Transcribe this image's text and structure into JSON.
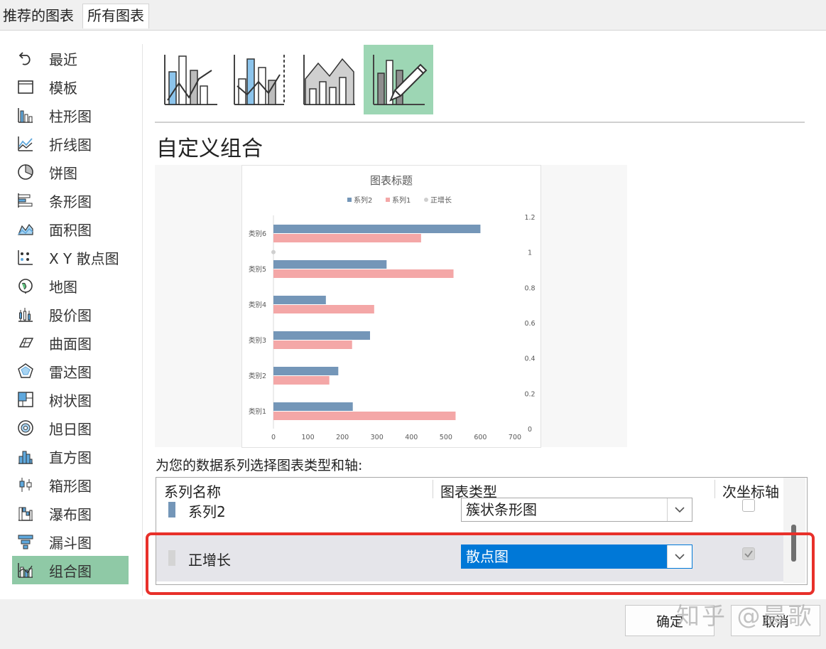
{
  "tabs": [
    {
      "label": "推荐的图表"
    },
    {
      "label": "所有图表"
    }
  ],
  "sidebar": {
    "items": [
      {
        "label": "最近",
        "icon": "recent-icon"
      },
      {
        "label": "模板",
        "icon": "folder-icon"
      },
      {
        "label": "柱形图",
        "icon": "column-chart-icon"
      },
      {
        "label": "折线图",
        "icon": "line-chart-icon"
      },
      {
        "label": "饼图",
        "icon": "pie-chart-icon"
      },
      {
        "label": "条形图",
        "icon": "bar-chart-icon"
      },
      {
        "label": "面积图",
        "icon": "area-chart-icon"
      },
      {
        "label": "X Y 散点图",
        "icon": "scatter-chart-icon"
      },
      {
        "label": "地图",
        "icon": "map-chart-icon"
      },
      {
        "label": "股价图",
        "icon": "stock-chart-icon"
      },
      {
        "label": "曲面图",
        "icon": "surface-chart-icon"
      },
      {
        "label": "雷达图",
        "icon": "radar-chart-icon"
      },
      {
        "label": "树状图",
        "icon": "treemap-chart-icon"
      },
      {
        "label": "旭日图",
        "icon": "sunburst-chart-icon"
      },
      {
        "label": "直方图",
        "icon": "histogram-chart-icon"
      },
      {
        "label": "箱形图",
        "icon": "boxplot-chart-icon"
      },
      {
        "label": "瀑布图",
        "icon": "waterfall-chart-icon"
      },
      {
        "label": "漏斗图",
        "icon": "funnel-chart-icon"
      },
      {
        "label": "组合图",
        "icon": "combo-chart-icon",
        "selected": true
      }
    ]
  },
  "section_title": "自定义组合",
  "chart_data": {
    "type": "bar",
    "title": "图表标题",
    "categories": [
      "类别1",
      "类别2",
      "类别3",
      "类别4",
      "类别5",
      "类别6"
    ],
    "series": [
      {
        "name": "系列2",
        "values": [
          230,
          188,
          280,
          152,
          328,
          600
        ],
        "color": "#7496b8"
      },
      {
        "name": "系列1",
        "values": [
          528,
          162,
          228,
          292,
          522,
          428
        ],
        "color": "#f4a7a7"
      },
      {
        "name": "正增长",
        "type": "scatter",
        "values": [
          null,
          null,
          null,
          null,
          null,
          1
        ],
        "color": "#cfcfcf"
      }
    ],
    "xticks": [
      "0",
      "100",
      "200",
      "300",
      "400",
      "500",
      "600",
      "700"
    ],
    "xlim": [
      0,
      700
    ],
    "y2ticks": [
      "0",
      "0.2",
      "0.4",
      "0.6",
      "0.8",
      "1",
      "1.2"
    ],
    "y2lim": [
      0,
      1.2
    ],
    "legend": "top"
  },
  "prompt": "为您的数据系列选择图表类型和轴:",
  "grid": {
    "headers": {
      "name": "系列名称",
      "type": "图表类型",
      "secondary": "次坐标轴"
    },
    "rows": [
      {
        "name": "系列2",
        "type": "簇状条形图",
        "secondary": false,
        "color": "#7496b8"
      },
      {
        "name": "正增长",
        "type": "散点图",
        "secondary": true,
        "color": "#d4d4d4"
      }
    ]
  },
  "buttons": {
    "ok": "确定",
    "cancel": "取消"
  },
  "watermark": "知乎 @晨歌"
}
